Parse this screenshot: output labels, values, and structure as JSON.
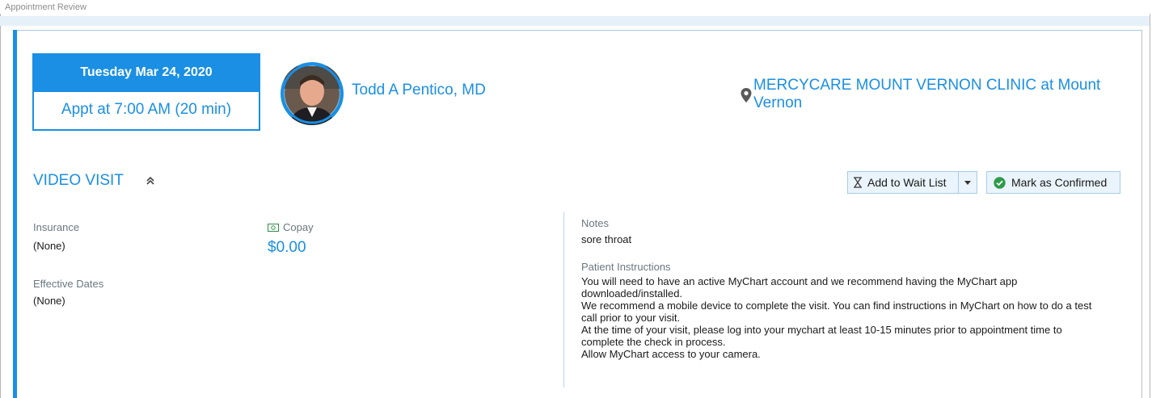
{
  "window": {
    "title": "Appointment Review"
  },
  "appointment": {
    "date": "Tuesday Mar 24, 2020",
    "time": "Appt at 7:00 AM (20 min)"
  },
  "provider": {
    "name": "Todd A Pentico, MD",
    "avatar_icon": "provider-photo"
  },
  "location": {
    "name": "MERCYCARE MOUNT VERNON CLINIC at Mount Vernon",
    "icon": "map-pin-icon"
  },
  "visit": {
    "type": "VIDEO VISIT",
    "collapse_icon": "double-chevron-up-icon"
  },
  "actions": {
    "wait_list_label": "Add to Wait List",
    "confirm_label": "Mark as Confirmed"
  },
  "insurance": {
    "label": "Insurance",
    "value": "(None)",
    "effective_label": "Effective Dates",
    "effective_value": "(None)"
  },
  "copay": {
    "label": "Copay",
    "value": "$0.00",
    "icon": "cash-icon"
  },
  "notes": {
    "label": "Notes",
    "value": "sore throat"
  },
  "patient_instructions": {
    "label": "Patient Instructions",
    "lines": [
      "You will need to have an active MyChart account and we recommend having the MyChart app downloaded/installed.",
      "We recommend a mobile device to complete the visit. You can find instructions in MyChart on how to do a test call prior to your visit.",
      "At the time of your visit, please log into your mychart at least 10-15 minutes prior to appointment time to complete the check in process.",
      "Allow MyChart access to your camera."
    ]
  },
  "colors": {
    "accent": "#1a8fe3",
    "button_bg": "#eaf4fc",
    "confirm_green": "#2e9b4a"
  }
}
